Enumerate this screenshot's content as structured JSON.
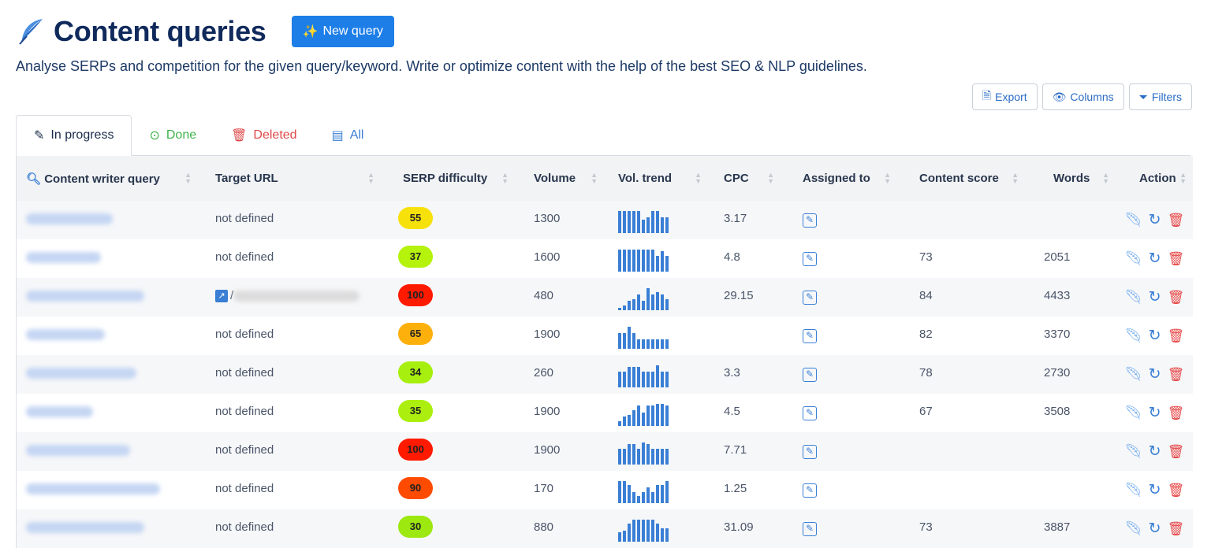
{
  "header": {
    "title": "Content queries",
    "new_query_label": "New query"
  },
  "subtitle": "Analyse SERPs and competition for the given query/keyword. Write or optimize content with the help of the best SEO & NLP guidelines.",
  "toolbar": {
    "export_label": "Export",
    "columns_label": "Columns",
    "filters_label": "Filters"
  },
  "tabs": [
    {
      "label": "In progress",
      "icon": "pencil-icon"
    },
    {
      "label": "Done",
      "icon": "check-circle-icon"
    },
    {
      "label": "Deleted",
      "icon": "trash-icon"
    },
    {
      "label": "All",
      "icon": "list-icon"
    }
  ],
  "columns": [
    "Content writer query",
    "Target URL",
    "SERP difficulty",
    "Volume",
    "Vol. trend",
    "CPC",
    "Assigned to",
    "Content score",
    "Words",
    "Action"
  ],
  "colors": {
    "accent": "#1d7ee8",
    "difficulty": {
      "55": "#f7e10a",
      "37": "#b5f20c",
      "100": "#ff1a00",
      "65": "#fdb00c",
      "34": "#a6ef0e",
      "35": "#acef0e",
      "90": "#ff4b00",
      "30": "#9ce80f"
    }
  },
  "rows": [
    {
      "target_url": "not defined",
      "difficulty": "55",
      "volume": "1300",
      "trend": [
        10,
        10,
        10,
        10,
        10,
        6,
        7,
        10,
        10,
        7,
        7
      ],
      "cpc": "3.17",
      "score": "",
      "words": ""
    },
    {
      "target_url": "not defined",
      "difficulty": "37",
      "volume": "1600",
      "trend": [
        10,
        10,
        10,
        10,
        10,
        10,
        10,
        10,
        7,
        9,
        7
      ],
      "cpc": "4.8",
      "score": "73",
      "words": "2051"
    },
    {
      "target_url": "/",
      "target_url_external": true,
      "difficulty": "100",
      "volume": "480",
      "trend": [
        1,
        2,
        4,
        5,
        7,
        4,
        10,
        7,
        8,
        7,
        5
      ],
      "cpc": "29.15",
      "score": "84",
      "words": "4433"
    },
    {
      "target_url": "not defined",
      "difficulty": "65",
      "volume": "1900",
      "trend": [
        7,
        7,
        10,
        7,
        4,
        4,
        4,
        4,
        4,
        4,
        4
      ],
      "cpc": "",
      "score": "82",
      "words": "3370"
    },
    {
      "target_url": "not defined",
      "difficulty": "34",
      "volume": "260",
      "trend": [
        7,
        7,
        9,
        9,
        9,
        7,
        7,
        7,
        10,
        7,
        7
      ],
      "cpc": "3.3",
      "score": "78",
      "words": "2730"
    },
    {
      "target_url": "not defined",
      "difficulty": "35",
      "volume": "1900",
      "trend": [
        2,
        4,
        5,
        7,
        9,
        6,
        9,
        9,
        10,
        10,
        9
      ],
      "cpc": "4.5",
      "score": "67",
      "words": "3508"
    },
    {
      "target_url": "not defined",
      "difficulty": "100",
      "volume": "1900",
      "trend": [
        7,
        7,
        9,
        9,
        7,
        10,
        9,
        7,
        7,
        7,
        7
      ],
      "cpc": "7.71",
      "score": "",
      "words": ""
    },
    {
      "target_url": "not defined",
      "difficulty": "90",
      "volume": "170",
      "trend": [
        10,
        10,
        8,
        5,
        3,
        5,
        7,
        5,
        8,
        8,
        10
      ],
      "cpc": "1.25",
      "score": "",
      "words": ""
    },
    {
      "target_url": "not defined",
      "difficulty": "30",
      "volume": "880",
      "trend": [
        4,
        5,
        8,
        10,
        10,
        10,
        10,
        10,
        8,
        6,
        6
      ],
      "cpc": "31.09",
      "score": "73",
      "words": "3887"
    }
  ]
}
